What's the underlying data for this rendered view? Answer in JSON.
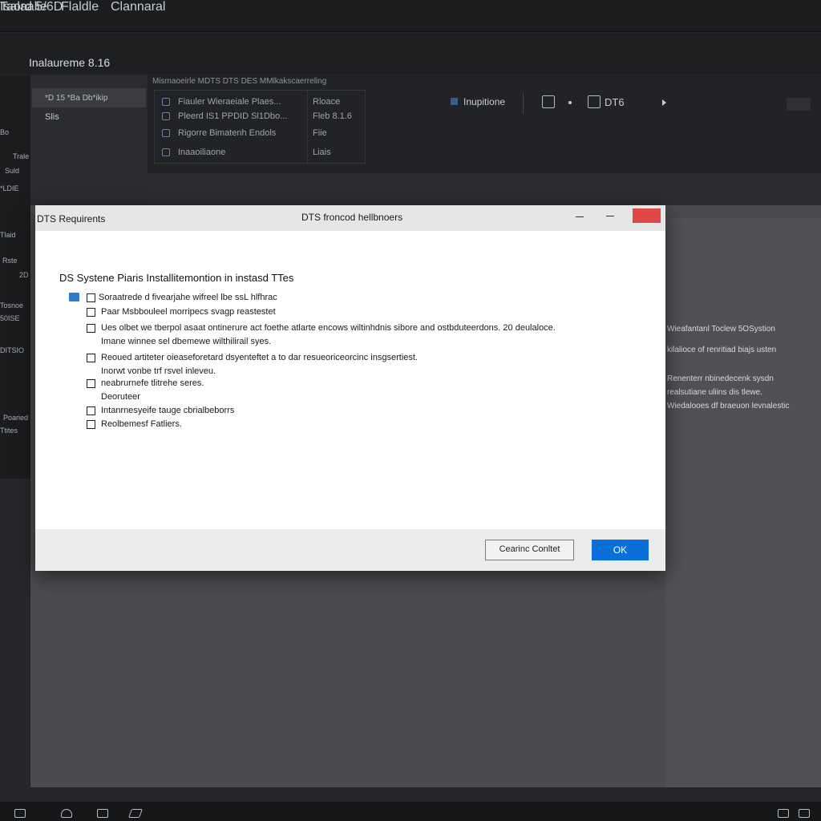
{
  "topbar": {
    "menus": [
      "Taord 5/6D",
      "Flaldle",
      "Clannaral"
    ],
    "window_title": "Isalaalie"
  },
  "app": {
    "title": "Inalaureme 8.16"
  },
  "left_labels": [
    "Bo ",
    "Trale",
    "Suld",
    "*LDIE",
    "Tlaid",
    "Rste",
    "2D",
    "Tosnoe",
    "50ISE",
    "DITSIO",
    "Poaried",
    "Ttites"
  ],
  "sidebar": {
    "selected_label": "*D 15 *Ba Db*ikip",
    "sub_label": "Slis"
  },
  "info": {
    "header": "Mismaoeirle MDTS DTS DES MMlkakscaerreling",
    "rows": [
      {
        "name": "Fiauler Wieraeiale Plaes...",
        "value": "Rloace"
      },
      {
        "name": "Pleerd IS1 PPDID Sl1Dbo...",
        "value": "Fleb 8.1.6"
      },
      {
        "name": "Rigorre Bimatenh Endols",
        "value": "Fiie"
      },
      {
        "name": "Inaaoiliaone",
        "value": "Liais"
      }
    ],
    "status_label": "Inupitione",
    "dts_label": "DT6"
  },
  "right_text": [
    "Wieafantanl Toclew 5OSystion",
    "kilalioce of renritiad biajs usten",
    "Renenterr nbinedecenk sysdn",
    "realsutiane uliins dis tlewe.",
    "Wiedalooes df braeuon levnalestic"
  ],
  "dialog": {
    "title_left": "DTS Requirents",
    "title_center": "DTS froncod hellbnoers",
    "heading": "DS Systene Piaris Installitemontion in instasd TTes",
    "items": [
      {
        "line1": "Soraatrede d fivearjahe wifreel lbe ssL hlfhrac",
        "line2": ""
      },
      {
        "line1": "Paar Msbbouleel morripecs svagp reastestet",
        "line2": ""
      },
      {
        "line1": "Ues olbet we tberpol asaat ontinerure act foethe atlarte encows wiltinhdnis sibore and ostbduteerdons. 20 deulaloce.",
        "line2": "Imane winnee sel dbemewe wilthilirail syes."
      },
      {
        "line1": "Reoued artiteter oieaseforetard dsyenteftet a to dar resueoriceorcinc insgsertiest.",
        "line2": "Inorwt vonbe trf rsvel inleveu."
      },
      {
        "line1": "neabrurnefe tlitrehe seres.",
        "line2": "Deoruteer"
      },
      {
        "line1": "Intanrnesyeife tauge cbrialbeborrs",
        "line2": ""
      },
      {
        "line1": "Reolbemesf Fatliers.",
        "line2": ""
      }
    ],
    "cancel_label": "Cearinc Conltet",
    "ok_label": "OK"
  },
  "colors": {
    "accent": "#0a6fd8",
    "close": "#e04848",
    "folder": "#2f7ad1"
  }
}
